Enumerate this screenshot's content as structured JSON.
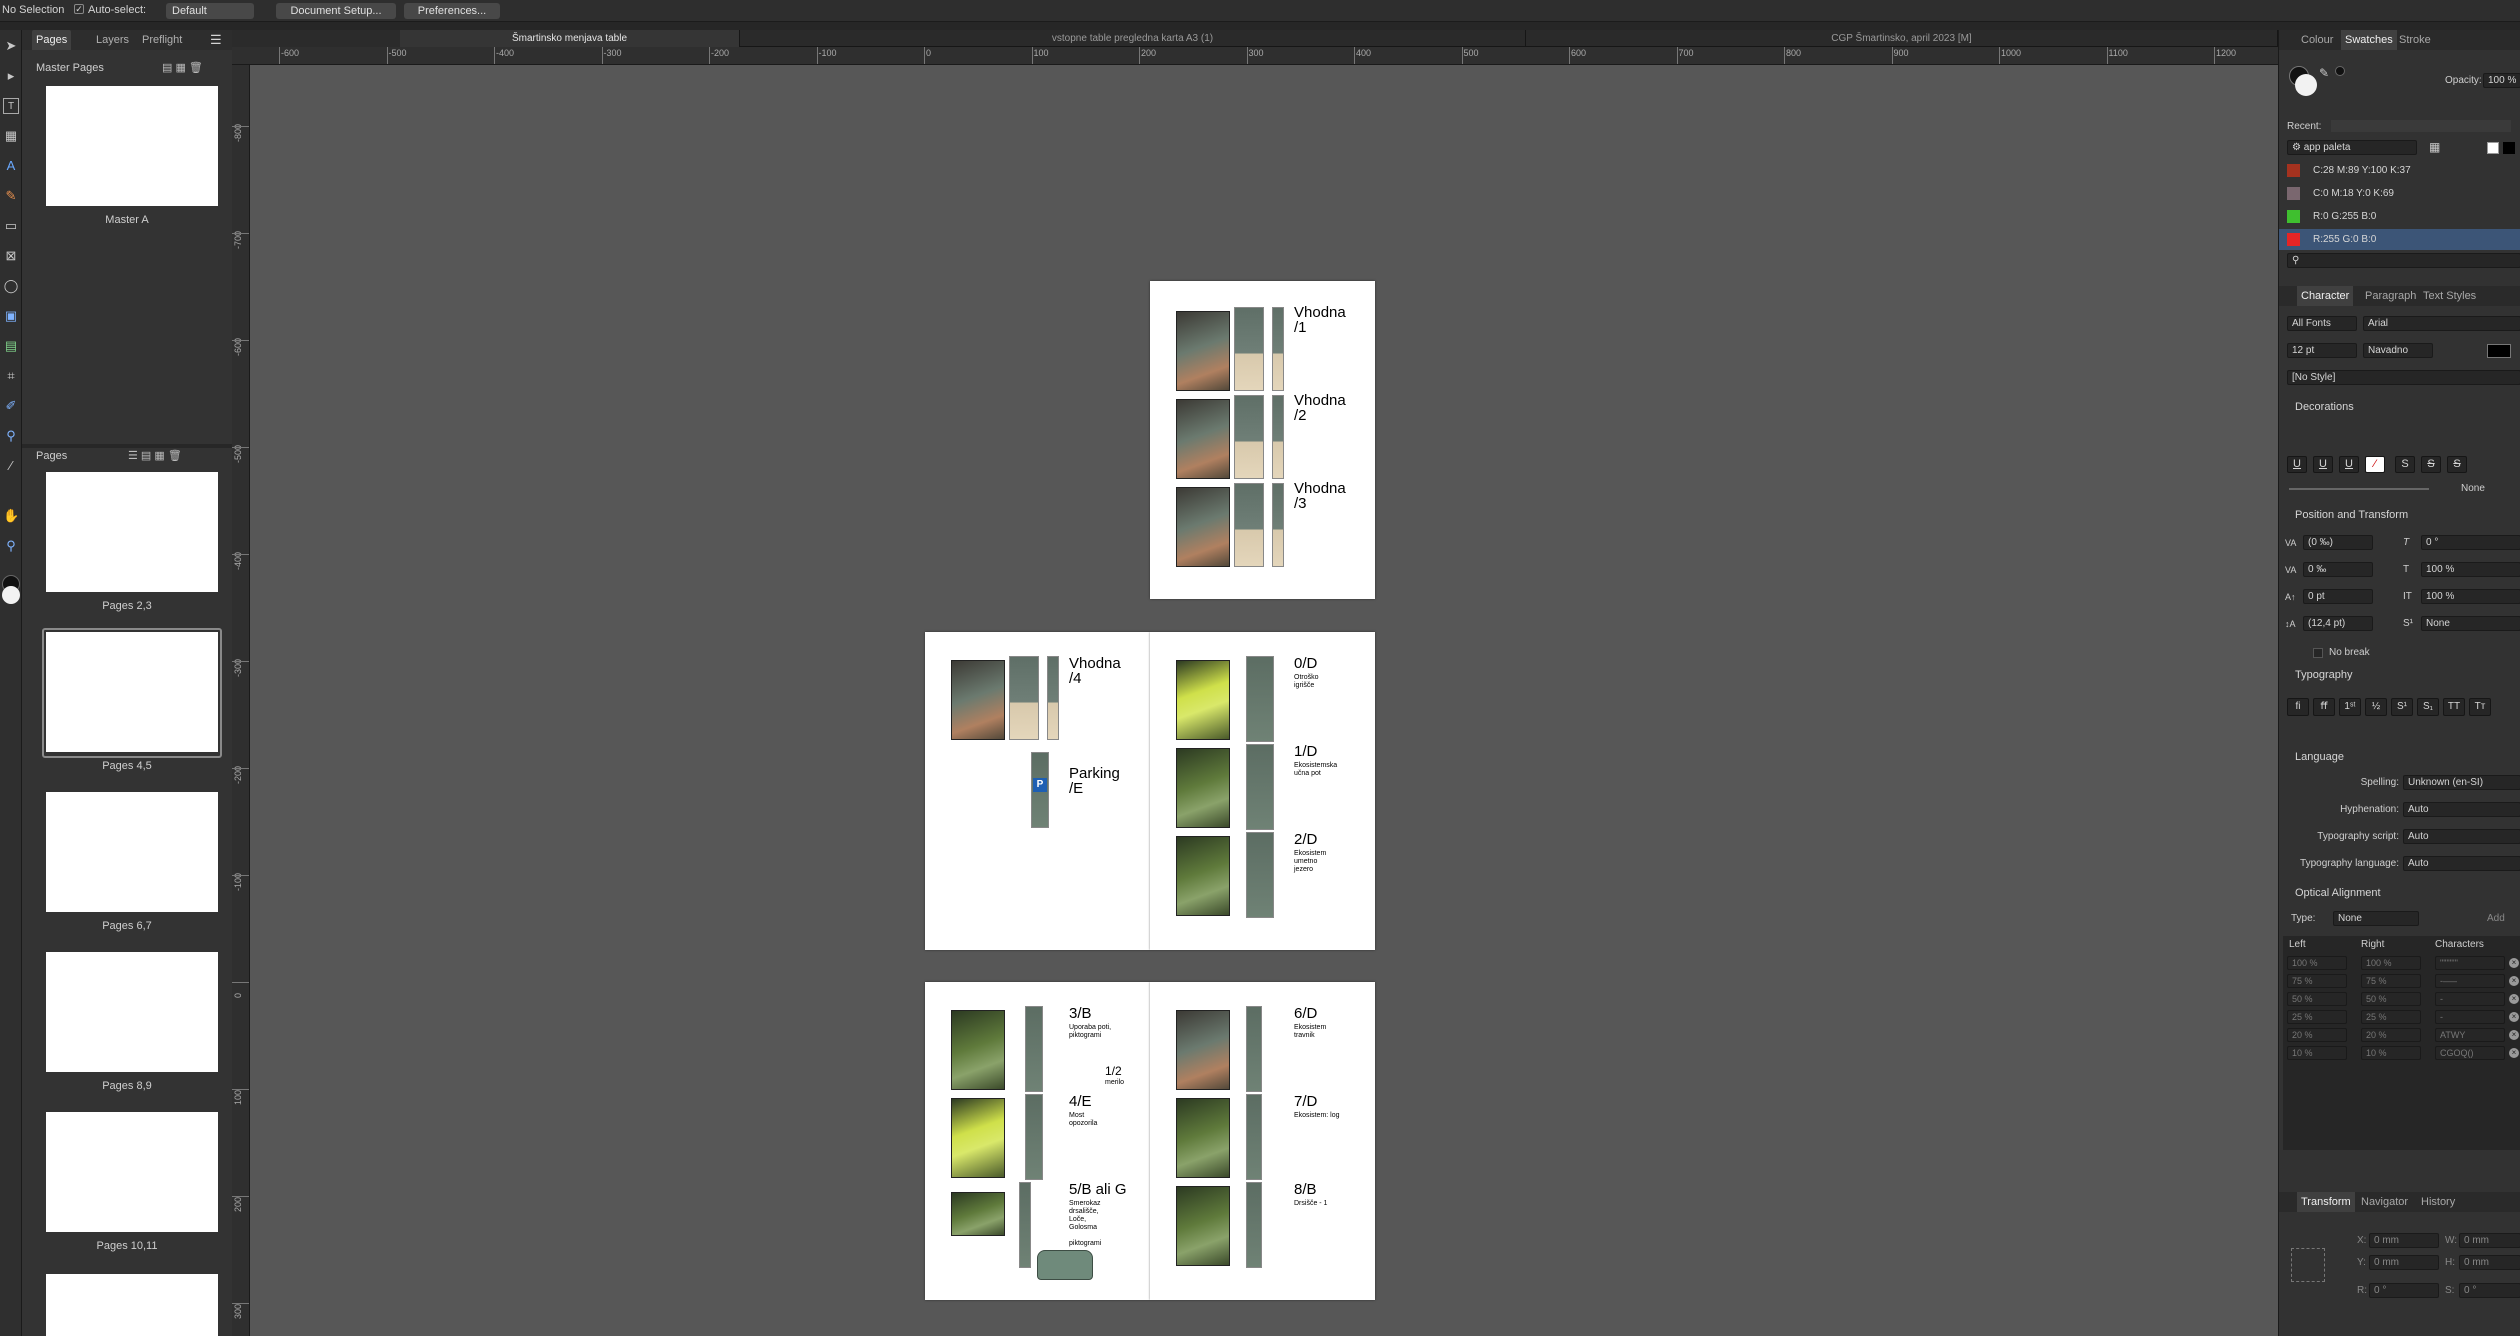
{
  "context_toolbar": {
    "selection": "No Selection",
    "auto_select_label": "Auto-select:",
    "auto_select_value": "Default",
    "document_setup": "Document Setup...",
    "preferences": "Preferences..."
  },
  "doc_tabs": [
    {
      "label": "Šmartinsko menjava table",
      "active": true
    },
    {
      "label": "vstopne table pregledna karta A3 (1)",
      "active": false
    },
    {
      "label": "CGP Šmartinsko, april 2023 [M]",
      "active": false
    }
  ],
  "left_panel": {
    "tabs": [
      "Pages",
      "Layers",
      "Preflight"
    ],
    "master_pages_title": "Master Pages",
    "master_label": "Master A",
    "pages_title": "Pages",
    "page_thumbs": [
      "Pages 2,3",
      "Pages 4,5",
      "Pages 6,7",
      "Pages 8,9",
      "Pages 10,11"
    ],
    "selected_thumb": "Pages 4,5"
  },
  "ruler": {
    "top_unit": "mm",
    "top_labels": [
      "-600",
      "-500",
      "-400",
      "-300",
      "-200",
      "-100",
      "0",
      "100",
      "200",
      "300",
      "400",
      "500",
      "600",
      "700",
      "800",
      "900",
      "1000",
      "1100",
      "1200"
    ],
    "left_labels": [
      "-800",
      "-700",
      "-600",
      "-500",
      "-400",
      "-300",
      "-200",
      "-100",
      "0",
      "100",
      "200",
      "300"
    ]
  },
  "spreads": {
    "page3": [
      {
        "label": "Vhodna\n/1"
      },
      {
        "label": "Vhodna\n/2"
      },
      {
        "label": "Vhodna\n/3"
      }
    ],
    "page4": [
      {
        "label": "Vhodna\n/4"
      },
      {
        "label": "Parking\n/E"
      }
    ],
    "page5": [
      {
        "label": "0/D",
        "sub": "Otroško\nigrišče"
      },
      {
        "label": "1/D",
        "sub": "Ekosistemska\nučna pot"
      },
      {
        "label": "2/D",
        "sub": "Ekosistem\numetno\njezero"
      }
    ],
    "page6": [
      {
        "label": "3/B",
        "sub": "Uporaba poti,\npiktogrami"
      },
      {
        "label": "1/2",
        "sub": "merilo"
      },
      {
        "label": "4/E",
        "sub": "Most\nopozorila"
      },
      {
        "label": "5/B ali G",
        "sub": "Smerokaz\ndrsališče,\nLoče,\nGolosma\n\npiktogrami"
      }
    ],
    "page7": [
      {
        "label": "6/D",
        "sub": "Ekosistem\ntravnik"
      },
      {
        "label": "7/D",
        "sub": "Ekosistem: log"
      },
      {
        "label": "8/B",
        "sub": "Drsišče - 1"
      }
    ]
  },
  "right_panel": {
    "top_tabs": [
      "Colour",
      "Swatches",
      "Stroke"
    ],
    "active_top_tab": "Swatches",
    "opacity_label": "Opacity:",
    "opacity_value": "100 %",
    "recent_label": "Recent:",
    "palette_name": "app paleta",
    "swatches": [
      {
        "name": "C:28 M:89 Y:100 K:37",
        "color": "#a5321f"
      },
      {
        "name": "C:0 M:18 Y:0 K:69",
        "color": "#7a676f"
      },
      {
        "name": "R:0 G:255 B:0",
        "color": "#3fbf2f"
      },
      {
        "name": "R:255 G:0 B:0",
        "color": "#e52525"
      }
    ],
    "char_tabs": [
      "Character",
      "Paragraph",
      "Text Styles"
    ],
    "font_collection": "All Fonts",
    "font_family": "Arial",
    "font_size": "12 pt",
    "font_style": "Navadno",
    "char_style": "[No Style]",
    "decorations_title": "Decorations",
    "decoration_none": "None",
    "pos_title": "Position and Transform",
    "kerning": "(0 ‰)",
    "tracking": "0 ‰",
    "baseline": "0 pt",
    "leading": "(12,4 pt)",
    "skew": "0 °",
    "hscale": "100 %",
    "vscale": "100 %",
    "position": "None",
    "no_break": "No break",
    "typography_title": "Typography",
    "language_title": "Language",
    "spelling_label": "Spelling:",
    "spelling_value": "Unknown (en-SI)",
    "hyphenation_label": "Hyphenation:",
    "hyphenation_value": "Auto",
    "typo_script_label": "Typography script:",
    "typo_script_value": "Auto",
    "typo_lang_label": "Typography language:",
    "typo_lang_value": "Auto",
    "optical_title": "Optical Alignment",
    "optical_type_label": "Type:",
    "optical_type_value": "None",
    "add_label": "Add",
    "opt_headers": [
      "Left",
      "Right",
      "Characters"
    ],
    "opt_rows": [
      {
        "left": "100 %",
        "right": "100 %",
        "chars": "\"'\"\"'\"'"
      },
      {
        "left": "75 %",
        "right": "75 %",
        "chars": "-–—"
      },
      {
        "left": "50 %",
        "right": "50 %",
        "chars": "-"
      },
      {
        "left": "25 %",
        "right": "25 %",
        "chars": "-"
      },
      {
        "left": "20 %",
        "right": "20 %",
        "chars": "ATWY"
      },
      {
        "left": "10 %",
        "right": "10 %",
        "chars": "CGOQ()"
      }
    ],
    "bottom_tabs": [
      "Transform",
      "Navigator",
      "History"
    ],
    "x_label": "X:",
    "x_value": "0 mm",
    "y_label": "Y:",
    "y_value": "0 mm",
    "w_label": "W:",
    "w_value": "0 mm",
    "h_label": "H:",
    "h_value": "0 mm",
    "r_label": "R:",
    "r_value": "0 °",
    "s_label": "S:",
    "s_value": "0 °"
  }
}
